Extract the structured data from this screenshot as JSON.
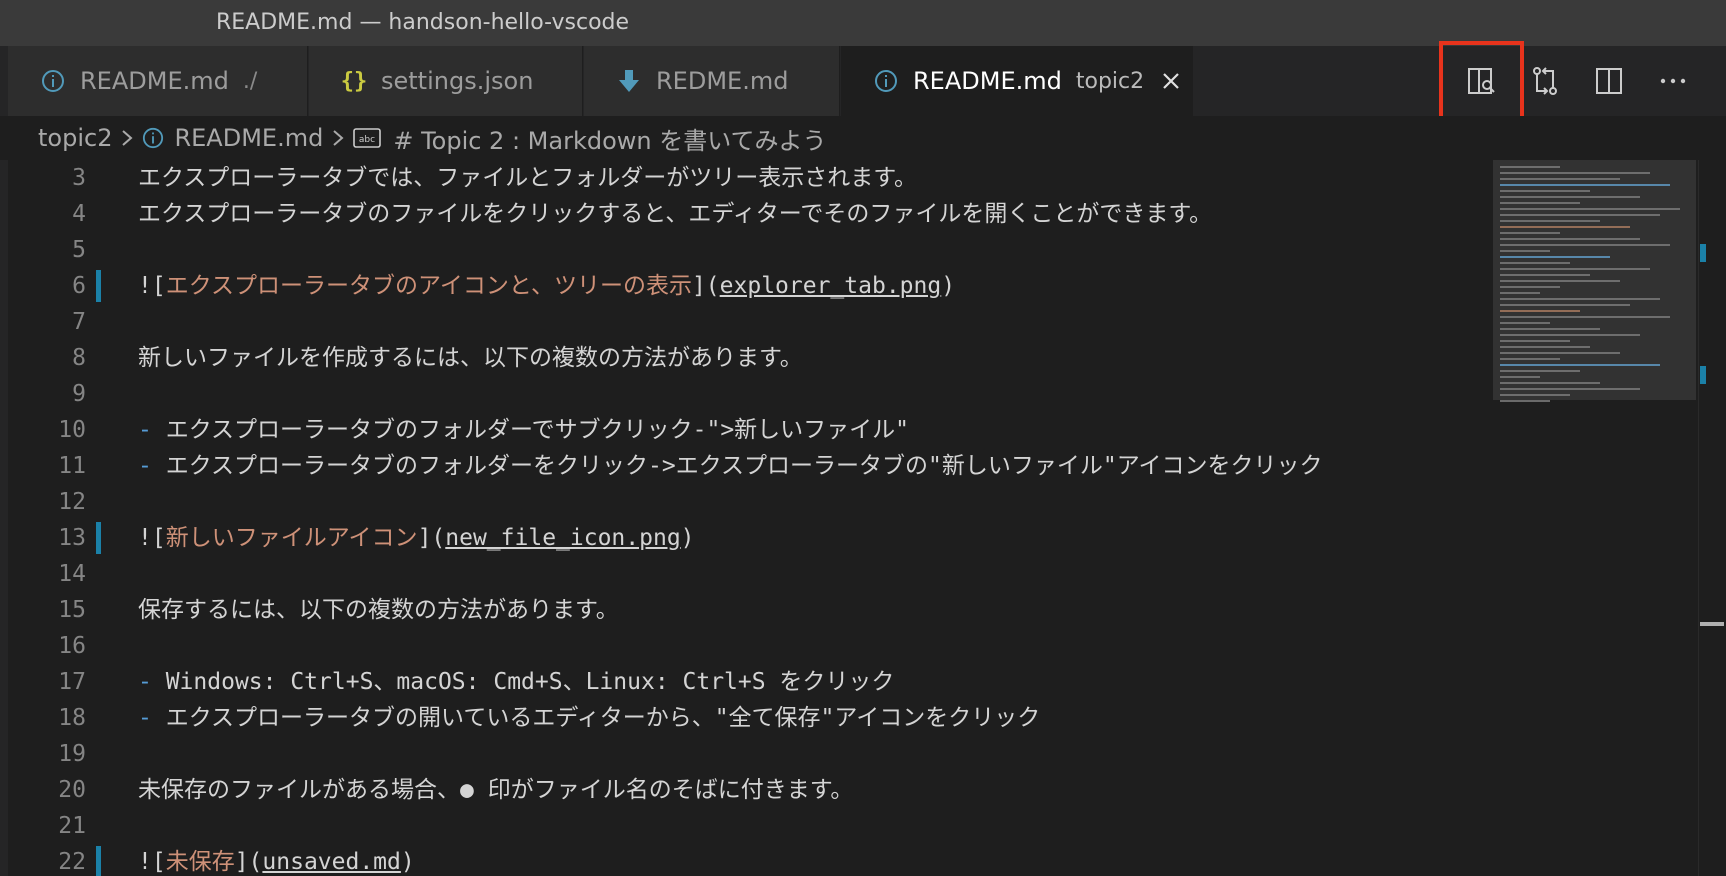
{
  "window": {
    "title": "README.md — handson-hello-vscode"
  },
  "tabs": [
    {
      "label": "README.md",
      "desc": "./",
      "icon": "info-icon",
      "active": false
    },
    {
      "label": "settings.json",
      "desc": "",
      "icon": "json-braces-icon",
      "active": false
    },
    {
      "label": "REDME.md",
      "desc": "",
      "icon": "markdown-download-icon",
      "active": false
    },
    {
      "label": "README.md",
      "desc": "topic2",
      "icon": "info-icon",
      "active": true
    }
  ],
  "tab_actions": [
    {
      "name": "open-preview-to-side-button",
      "icon": "preview-icon",
      "highlighted": true
    },
    {
      "name": "open-changes-button",
      "icon": "git-compare-icon",
      "highlighted": false
    },
    {
      "name": "split-editor-button",
      "icon": "split-editor-icon",
      "highlighted": false
    },
    {
      "name": "more-actions-button",
      "icon": "ellipsis-icon",
      "highlighted": false
    }
  ],
  "breadcrumb": {
    "folder": "topic2",
    "file": "README.md",
    "symbol": "# Topic 2 : Markdown を書いてみよう"
  },
  "lines": [
    {
      "n": "3",
      "text": "エクスプローラータブでは、ファイルとフォルダーがツリー表示されます。"
    },
    {
      "n": "4",
      "text": "エクスプローラータブのファイルをクリックすると、エディターでそのファイルを開くことができます。"
    },
    {
      "n": "5",
      "text": ""
    },
    {
      "n": "6",
      "link": {
        "alt": "エクスプローラータブのアイコンと、ツリーの表示",
        "url": "explorer_tab.png"
      }
    },
    {
      "n": "7",
      "text": ""
    },
    {
      "n": "8",
      "text": "新しいファイルを作成するには、以下の複数の方法があります。"
    },
    {
      "n": "9",
      "text": ""
    },
    {
      "n": "10",
      "bullet": "-",
      "text": "エクスプローラータブのフォルダーでサブクリック-\">新しいファイル\""
    },
    {
      "n": "11",
      "bullet": "-",
      "text": "エクスプローラータブのフォルダーをクリック->エクスプローラータブの\"新しいファイル\"アイコンをクリック"
    },
    {
      "n": "12",
      "text": ""
    },
    {
      "n": "13",
      "link": {
        "alt": "新しいファイルアイコン",
        "url": "new_file_icon.png"
      }
    },
    {
      "n": "14",
      "text": ""
    },
    {
      "n": "15",
      "text": "保存するには、以下の複数の方法があります。"
    },
    {
      "n": "16",
      "text": ""
    },
    {
      "n": "17",
      "bullet": "-",
      "text": "Windows: Ctrl+S、macOS: Cmd+S、Linux: Ctrl+S をクリック"
    },
    {
      "n": "18",
      "bullet": "-",
      "text": "エクスプローラータブの開いているエディターから、\"全て保存\"アイコンをクリック"
    },
    {
      "n": "19",
      "text": ""
    },
    {
      "n": "20",
      "text": "未保存のファイルがある場合、● 印がファイル名のそばに付きます。"
    },
    {
      "n": "21",
      "text": ""
    },
    {
      "n": "22",
      "link": {
        "alt": "未保存",
        "url": "unsaved.md"
      }
    }
  ],
  "colors": {
    "highlight": "#e8331c",
    "gutter_modified": "#1b81a8",
    "link_text": "#ce9178",
    "bullet": "#569cd6"
  }
}
